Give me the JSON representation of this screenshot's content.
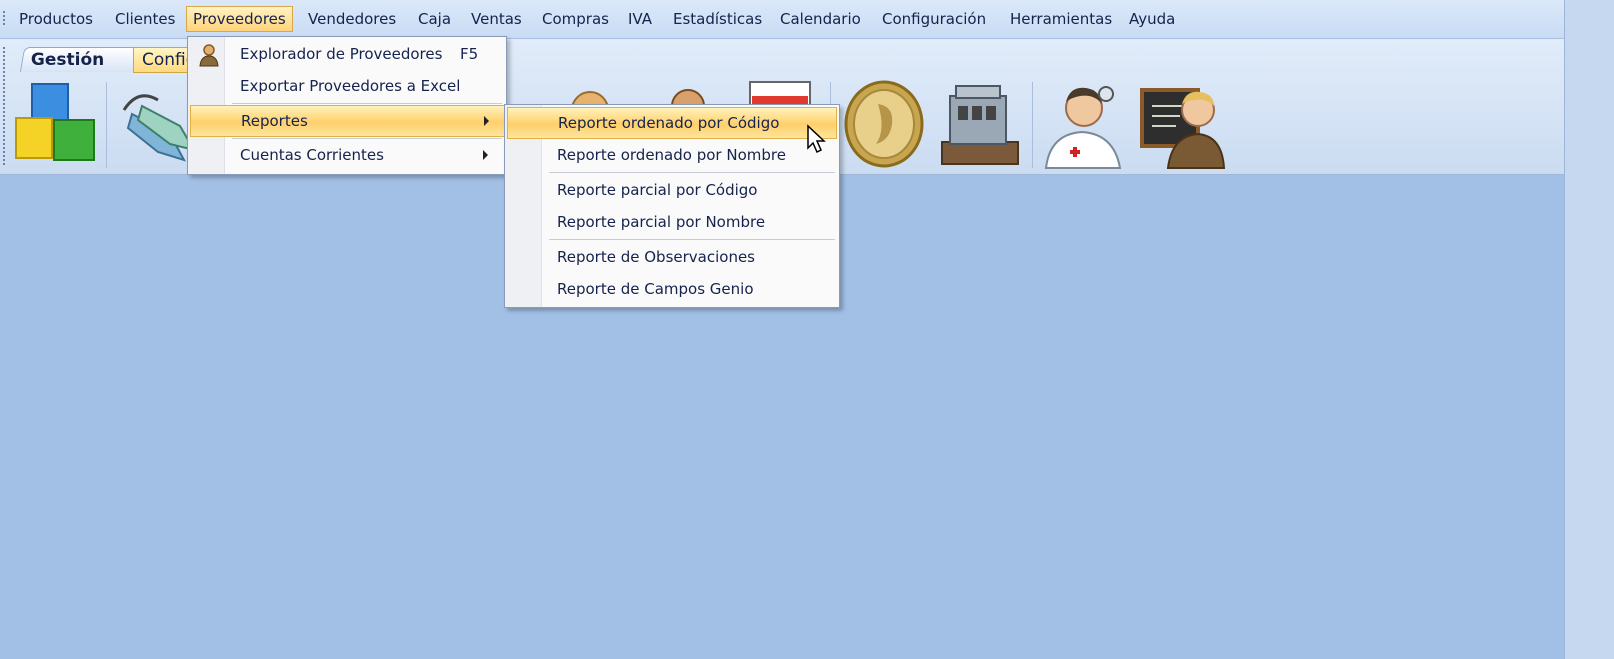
{
  "menubar": {
    "items": [
      "Productos",
      "Clientes",
      "Proveedores",
      "Vendedores",
      "Caja",
      "Ventas",
      "Compras",
      "IVA",
      "Estadísticas",
      "Calendario",
      "Configuración",
      "Herramientas",
      "Ayuda"
    ]
  },
  "ribbon": {
    "tabs": {
      "gestion": "Gestión",
      "config": "Configuración"
    },
    "icons": [
      "products-cubes-icon",
      "labels-tags-icon",
      "customer-icon",
      "seller-icon",
      "calendar-icon",
      "coin-icon",
      "cash-register-icon",
      "doctor-icon",
      "teacher-board-icon"
    ]
  },
  "dropdown": {
    "explorer_label": "Explorador de Proveedores",
    "explorer_shortcut": "F5",
    "export_label": "Exportar Proveedores a Excel",
    "reports_label": "Reportes",
    "accounts_label": "Cuentas Corrientes"
  },
  "submenu": {
    "items": [
      "Reporte ordenado por Código",
      "Reporte ordenado por Nombre",
      "Reporte parcial por Código",
      "Reporte parcial por Nombre",
      "Reporte de Observaciones",
      "Reporte de Campos Genio"
    ]
  },
  "colors": {
    "background": "#a2c0e6",
    "highlight": "#ffcf6a",
    "menubar": "#c9dcf4"
  }
}
